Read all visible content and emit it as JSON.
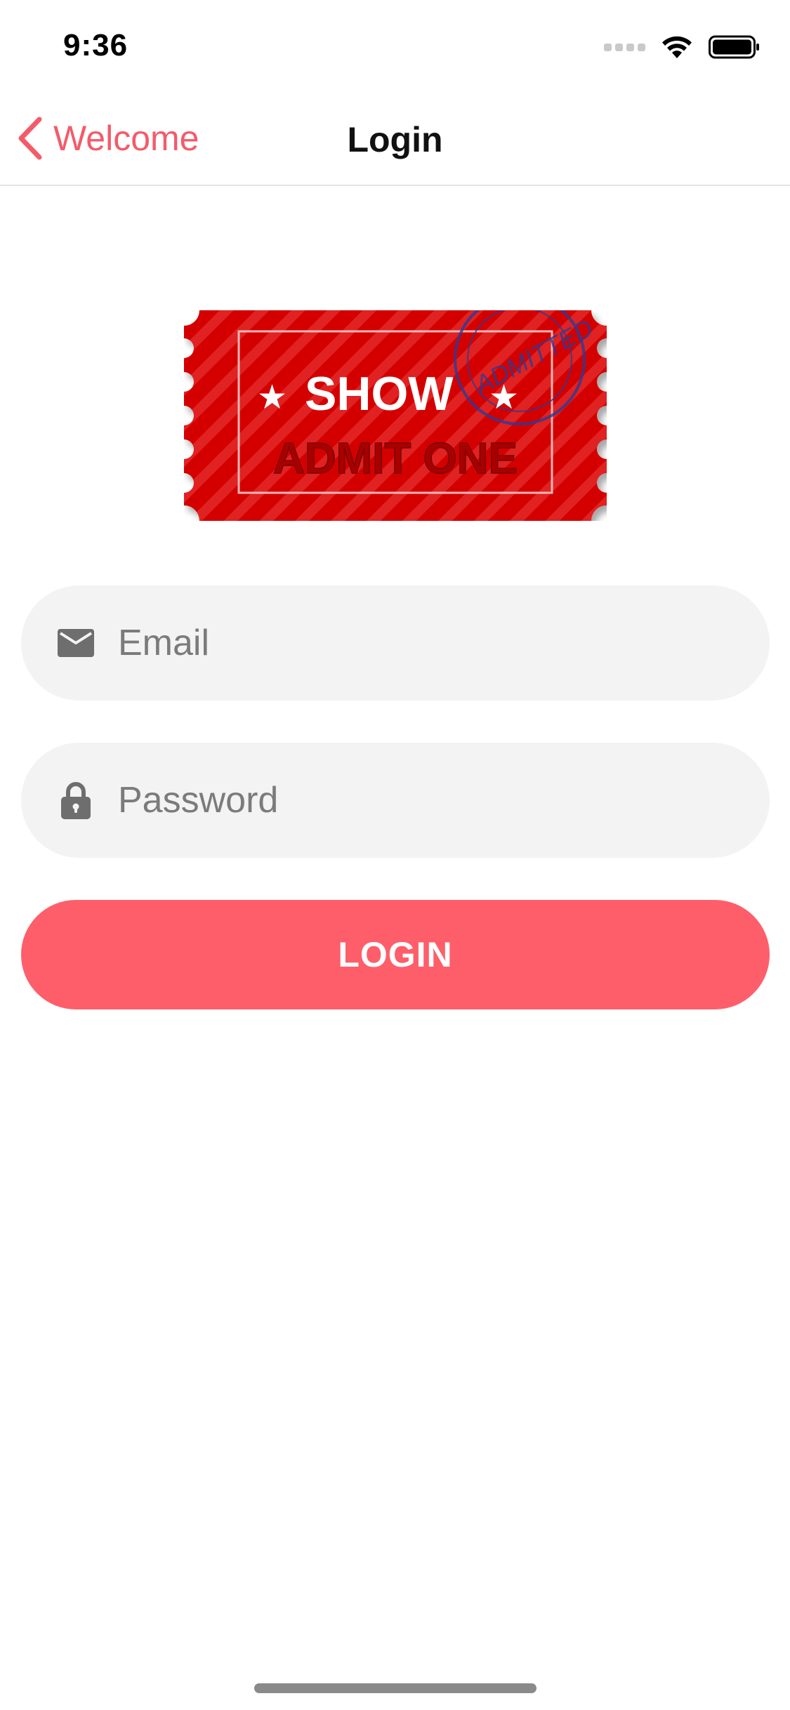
{
  "status_bar": {
    "time": "9:36"
  },
  "nav": {
    "back_label": "Welcome",
    "title": "Login"
  },
  "ticket": {
    "top_text": "SHOW",
    "bottom_text": "ADMIT ONE",
    "stamp_text": "ADMITTED"
  },
  "form": {
    "email_placeholder": "Email",
    "email_icon": "envelope-icon",
    "password_placeholder": "Password",
    "password_icon": "lock-icon",
    "login_label": "LOGIN"
  },
  "colors": {
    "accent": "#fe5e6a",
    "back_text": "#f35b6b",
    "field_bg": "#f3f3f3",
    "ticket_red": "#d10000"
  }
}
